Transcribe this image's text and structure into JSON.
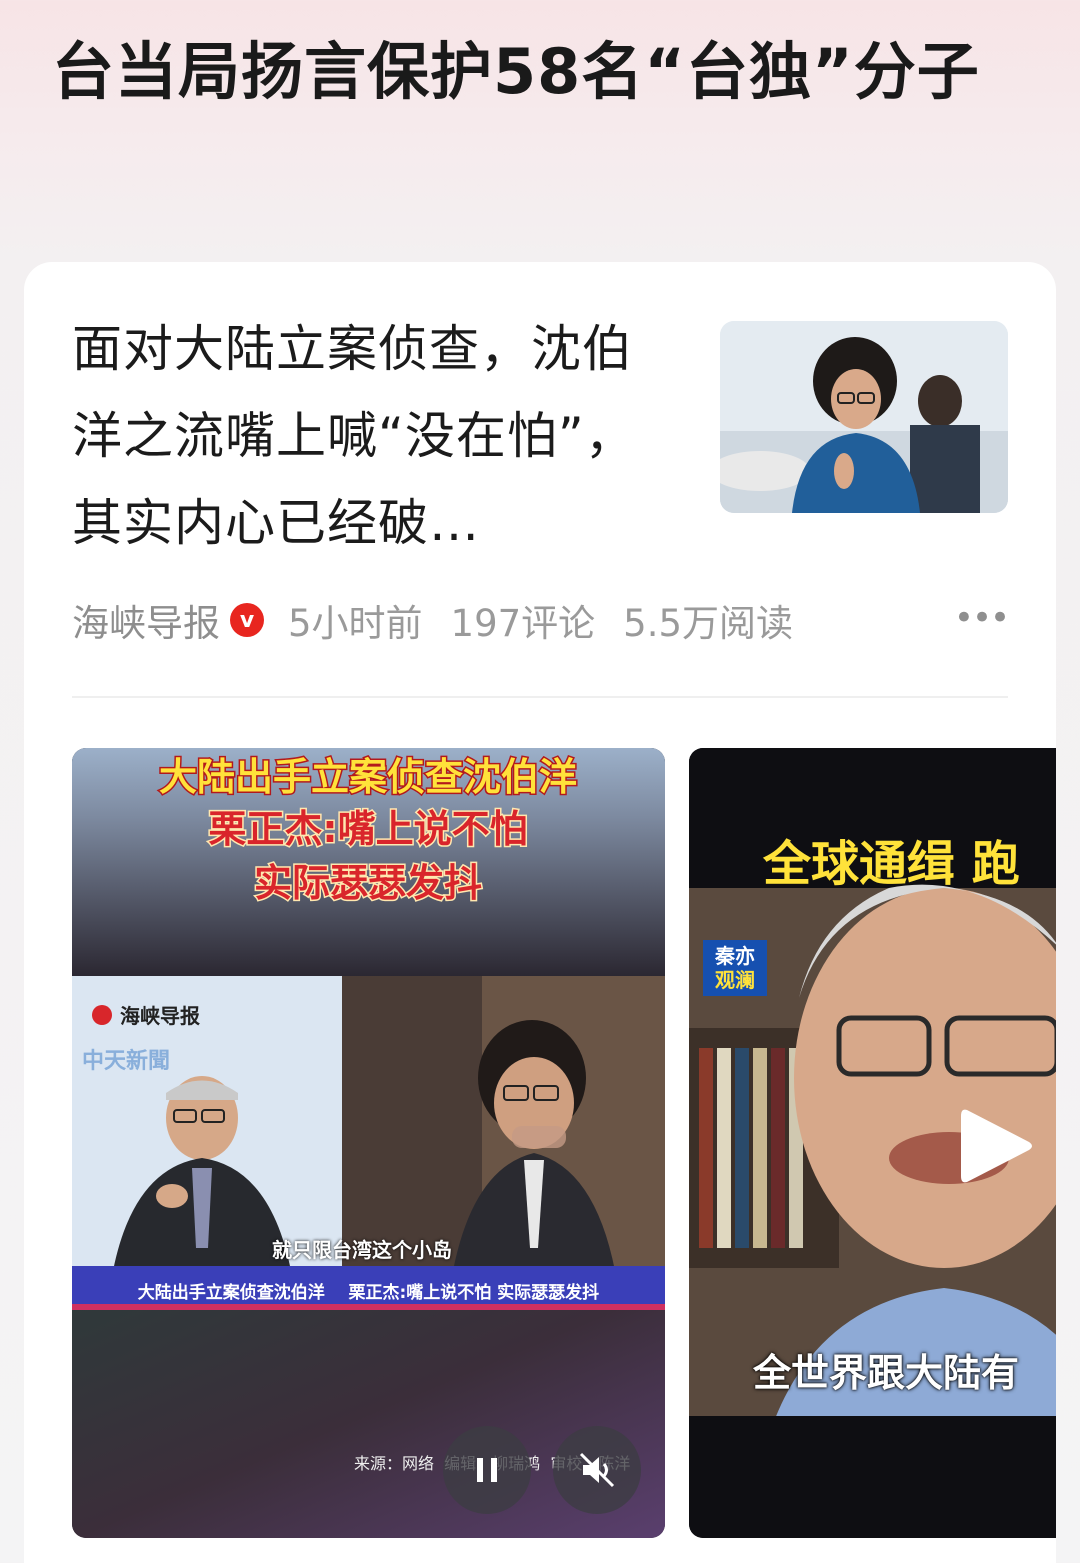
{
  "page": {
    "title": "台当局扬言保护58名“台独”分子"
  },
  "article": {
    "headline": "面对大陆立案侦查，沈伯洋之流嘴上喊“没在怕”，其实内心已经破…",
    "source": "海峡导报",
    "verified_badge": "v",
    "time": "5小时前",
    "comments": "197评论",
    "reads": "5.5万阅读",
    "more_label": "•••"
  },
  "video1": {
    "banner_line1": "大陆出手立案侦查沈伯洋",
    "banner_line2": "栗正杰:嘴上说不怕",
    "banner_line3": "实际瑟瑟发抖",
    "logo_text": "海峡导报",
    "station_text": "中天新聞",
    "subtitle": "就只限台湾这个小岛",
    "ticker": "大陆出手立案侦查沈伯洋    栗正杰:嘴上说不怕 实际瑟瑟发抖",
    "credits": "来源：网络  编辑：柳瑞鸿  审校：陈洋"
  },
  "video2": {
    "headline": "全球通缉 跑",
    "badge_line1": "秦亦",
    "badge_line2": "观澜",
    "caption": "全世界跟大陆有"
  },
  "colors": {
    "accent_red": "#e8261f",
    "banner_yellow": "#ffe23a"
  },
  "icons": {
    "pause": "pause-icon",
    "mute": "mute-icon",
    "play": "play-icon"
  }
}
